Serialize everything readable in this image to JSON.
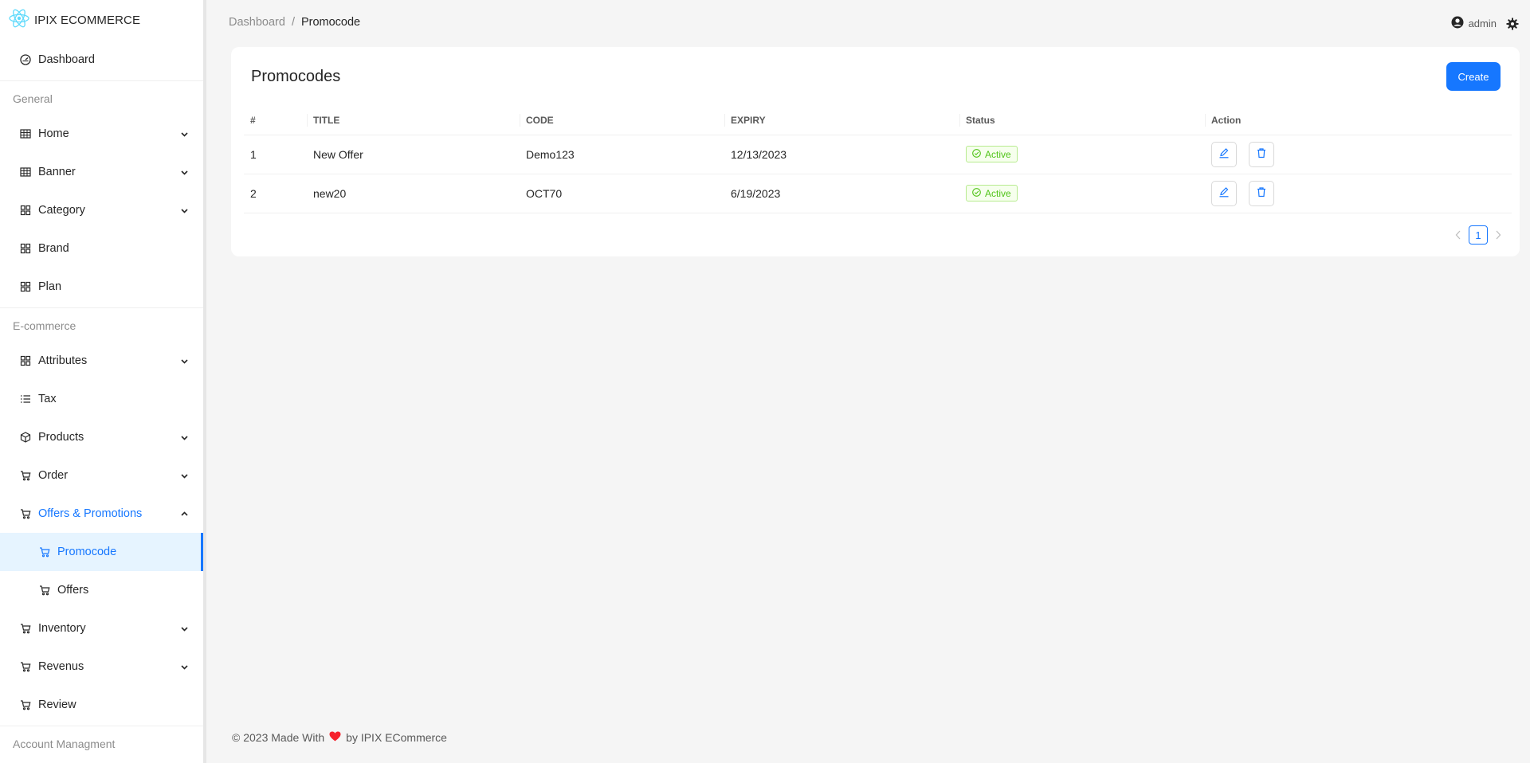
{
  "brand": {
    "name": "IPIX ECOMMERCE",
    "icon": "react-atom-icon"
  },
  "sidebar": {
    "dashboard": {
      "label": "Dashboard",
      "icon": "dashboard-icon"
    },
    "groups": {
      "general": "General",
      "ecommerce": "E-commerce",
      "account": "Account Managment"
    },
    "general_items": [
      {
        "label": "Home",
        "icon": "table-icon",
        "expandable": true
      },
      {
        "label": "Banner",
        "icon": "table-icon",
        "expandable": true
      },
      {
        "label": "Category",
        "icon": "appstore-icon",
        "expandable": true
      },
      {
        "label": "Brand",
        "icon": "appstore-icon",
        "expandable": false
      },
      {
        "label": "Plan",
        "icon": "appstore-icon",
        "expandable": false
      }
    ],
    "ecommerce_items": [
      {
        "label": "Attributes",
        "icon": "appstore-icon",
        "expandable": true
      },
      {
        "label": "Tax",
        "icon": "list-icon",
        "expandable": false
      },
      {
        "label": "Products",
        "icon": "box-icon",
        "expandable": true
      },
      {
        "label": "Order",
        "icon": "cart-icon",
        "expandable": true
      },
      {
        "label": "Offers & Promotions",
        "icon": "cart-icon",
        "expandable": true,
        "open": true
      }
    ],
    "offers_sub": [
      {
        "label": "Promocode",
        "icon": "cart-icon",
        "active": true
      },
      {
        "label": "Offers",
        "icon": "cart-icon",
        "active": false
      }
    ],
    "after_items": [
      {
        "label": "Inventory",
        "icon": "cart-icon",
        "expandable": true
      },
      {
        "label": "Revenus",
        "icon": "cart-icon",
        "expandable": true
      },
      {
        "label": "Review",
        "icon": "cart-icon",
        "expandable": false
      }
    ]
  },
  "breadcrumb": {
    "root": "Dashboard",
    "separator": "/",
    "current": "Promocode"
  },
  "user": {
    "name": "admin",
    "icon": "user-circle-icon",
    "settings_icon": "gear-icon"
  },
  "card": {
    "title": "Promocodes",
    "create_label": "Create"
  },
  "table": {
    "columns": [
      "#",
      "TITLE",
      "CODE",
      "EXPIRY",
      "Status",
      "Action"
    ],
    "rows": [
      {
        "index": "1",
        "title": "New Offer",
        "code": "Demo123",
        "expiry": "12/13/2023",
        "status": "Active"
      },
      {
        "index": "2",
        "title": "new20",
        "code": "OCT70",
        "expiry": "6/19/2023",
        "status": "Active"
      }
    ]
  },
  "pagination": {
    "current": "1"
  },
  "footer": {
    "prefix": "© 2023 Made With",
    "suffix": "by IPIX ECommerce"
  },
  "colors": {
    "primary": "#1677ff",
    "success": "#52c41a",
    "heart": "#f5222d"
  }
}
